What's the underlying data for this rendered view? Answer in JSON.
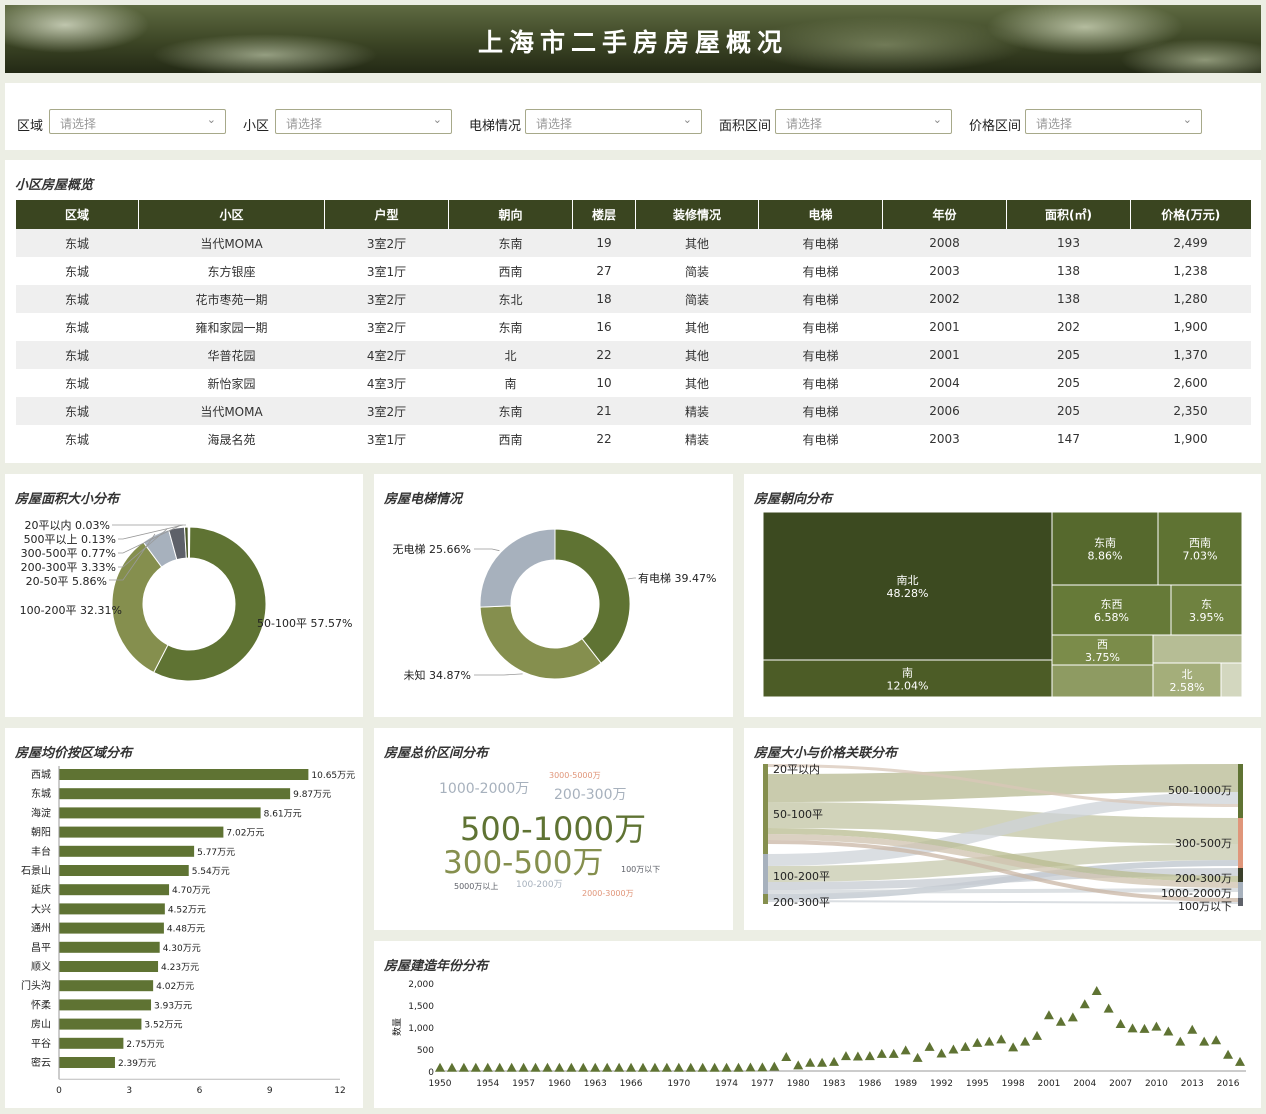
{
  "title": "上海市二手房房屋概况",
  "filters": [
    {
      "label": "区域",
      "placeholder": "请选择"
    },
    {
      "label": "小区",
      "placeholder": "请选择"
    },
    {
      "label": "电梯情况",
      "placeholder": "请选择"
    },
    {
      "label": "面积区间",
      "placeholder": "请选择"
    },
    {
      "label": "价格区间",
      "placeholder": "请选择"
    }
  ],
  "table": {
    "title": "小区房屋概览",
    "headers": [
      "区域",
      "小区",
      "户型",
      "朝向",
      "楼层",
      "装修情况",
      "电梯",
      "年份",
      "面积(㎡)",
      "价格(万元)"
    ],
    "rows": [
      [
        "东城",
        "当代MOMA",
        "3室2厅",
        "东南",
        "19",
        "其他",
        "有电梯",
        "2008",
        "193",
        "2,499"
      ],
      [
        "东城",
        "东方银座",
        "3室1厅",
        "西南",
        "27",
        "简装",
        "有电梯",
        "2003",
        "138",
        "1,238"
      ],
      [
        "东城",
        "花市枣苑一期",
        "3室2厅",
        "东北",
        "18",
        "简装",
        "有电梯",
        "2002",
        "138",
        "1,280"
      ],
      [
        "东城",
        "雍和家园一期",
        "3室2厅",
        "东南",
        "16",
        "其他",
        "有电梯",
        "2001",
        "202",
        "1,900"
      ],
      [
        "东城",
        "华普花园",
        "4室2厅",
        "北",
        "22",
        "其他",
        "有电梯",
        "2001",
        "205",
        "1,370"
      ],
      [
        "东城",
        "新怡家园",
        "4室3厅",
        "南",
        "10",
        "其他",
        "有电梯",
        "2004",
        "205",
        "2,600"
      ],
      [
        "东城",
        "当代MOMA",
        "3室2厅",
        "东南",
        "21",
        "精装",
        "有电梯",
        "2006",
        "205",
        "2,350"
      ],
      [
        "东城",
        "海晟名苑",
        "3室1厅",
        "西南",
        "22",
        "精装",
        "有电梯",
        "2003",
        "147",
        "1,900"
      ]
    ]
  },
  "panels": {
    "area": "房屋面积大小分布",
    "elevator": "房屋电梯情况",
    "orientation": "房屋朝向分布",
    "district_price": "房屋均价按区域分布",
    "price_range": "房屋总价区间分布",
    "size_price": "房屋大小与价格关联分布",
    "year": "房屋建造年份分布"
  },
  "colors": {
    "dark": "#3a4520",
    "olive": "#5f7333",
    "olive_light": "#858f4e",
    "gray_blue": "#a7b1bd",
    "salmon": "#e0967a"
  },
  "chart_data": [
    {
      "type": "pie",
      "name": "area",
      "slices": [
        {
          "label": "50-100平",
          "value": 57.57,
          "text": "50-100平 57.57%"
        },
        {
          "label": "100-200平",
          "value": 32.31,
          "text": "100-200平 32.31%"
        },
        {
          "label": "20-50平",
          "value": 5.86,
          "text": "20-50平 5.86%"
        },
        {
          "label": "200-300平",
          "value": 3.33,
          "text": "200-300平 3.33%"
        },
        {
          "label": "300-500平",
          "value": 0.77,
          "text": "300-500平 0.77%"
        },
        {
          "label": "500平以上",
          "value": 0.13,
          "text": "500平以上 0.13%"
        },
        {
          "label": "20平以内",
          "value": 0.03,
          "text": "20平以内 0.03%"
        }
      ]
    },
    {
      "type": "pie",
      "name": "elevator",
      "slices": [
        {
          "label": "有电梯",
          "value": 39.47,
          "text": "有电梯 39.47%"
        },
        {
          "label": "未知",
          "value": 34.87,
          "text": "未知 34.87%"
        },
        {
          "label": "无电梯",
          "value": 25.66,
          "text": "无电梯 25.66%"
        }
      ]
    },
    {
      "type": "treemap",
      "name": "orientation",
      "items": [
        {
          "label": "南北",
          "value": "48.28%"
        },
        {
          "label": "南",
          "value": "12.04%"
        },
        {
          "label": "东南",
          "value": "8.86%"
        },
        {
          "label": "西南",
          "value": "7.03%"
        },
        {
          "label": "东西",
          "value": "6.58%"
        },
        {
          "label": "东",
          "value": "3.95%"
        },
        {
          "label": "西",
          "value": "3.75%"
        },
        {
          "label": "北",
          "value": "2.58%"
        }
      ]
    },
    {
      "type": "bar",
      "name": "district_price",
      "orientation": "horizontal",
      "categories": [
        "西城",
        "东城",
        "海淀",
        "朝阳",
        "丰台",
        "石景山",
        "延庆",
        "大兴",
        "通州",
        "昌平",
        "顺义",
        "门头沟",
        "怀柔",
        "房山",
        "平谷",
        "密云"
      ],
      "values": [
        10.65,
        9.87,
        8.61,
        7.02,
        5.77,
        5.54,
        4.7,
        4.52,
        4.48,
        4.3,
        4.23,
        4.02,
        3.93,
        3.52,
        2.75,
        2.39
      ],
      "labels": [
        "10.65万元",
        "9.87万元",
        "8.61万元",
        "7.02万元",
        "5.77万元",
        "5.54万元",
        "4.70万元",
        "4.52万元",
        "4.48万元",
        "4.30万元",
        "4.23万元",
        "4.02万元",
        "3.93万元",
        "3.52万元",
        "2.75万元",
        "2.39万元"
      ],
      "xlim": [
        0,
        12
      ],
      "xticks": [
        "0",
        "3",
        "6",
        "9",
        "12"
      ]
    },
    {
      "type": "wordcloud",
      "name": "price_range",
      "words": [
        "500-1000万",
        "300-500万",
        "1000-2000万",
        "200-300万",
        "3000-5000万",
        "100万以下",
        "5000万以上",
        "100-200万",
        "2000-3000万"
      ]
    },
    {
      "type": "sankey",
      "name": "size_price",
      "left_nodes": [
        "20平以内",
        "50-100平",
        "100-200平",
        "200-300平"
      ],
      "right_nodes": [
        "500-1000万",
        "300-500万",
        "200-300万",
        "1000-2000万",
        "100万以下"
      ]
    },
    {
      "type": "scatter",
      "name": "year",
      "ylabel": "数量",
      "ylim": [
        0,
        2000
      ],
      "yticks": [
        "0",
        "500",
        "1,000",
        "1,500",
        "2,000"
      ],
      "xticks": [
        "1950",
        "1954",
        "1957",
        "1960",
        "1963",
        "1966",
        "1970",
        "1974",
        "1977",
        "1980",
        "1983",
        "1986",
        "1989",
        "1992",
        "1995",
        "1998",
        "2001",
        "2004",
        "2007",
        "2010",
        "2013",
        "2016"
      ],
      "points": [
        [
          1950,
          5
        ],
        [
          1951,
          5
        ],
        [
          1952,
          5
        ],
        [
          1953,
          5
        ],
        [
          1954,
          5
        ],
        [
          1955,
          5
        ],
        [
          1956,
          5
        ],
        [
          1957,
          5
        ],
        [
          1958,
          5
        ],
        [
          1959,
          5
        ],
        [
          1960,
          5
        ],
        [
          1961,
          5
        ],
        [
          1962,
          5
        ],
        [
          1963,
          5
        ],
        [
          1964,
          5
        ],
        [
          1965,
          5
        ],
        [
          1966,
          5
        ],
        [
          1967,
          5
        ],
        [
          1968,
          5
        ],
        [
          1969,
          5
        ],
        [
          1970,
          5
        ],
        [
          1971,
          5
        ],
        [
          1972,
          5
        ],
        [
          1973,
          5
        ],
        [
          1974,
          5
        ],
        [
          1975,
          5
        ],
        [
          1976,
          10
        ],
        [
          1977,
          15
        ],
        [
          1978,
          30
        ],
        [
          1979,
          250
        ],
        [
          1980,
          60
        ],
        [
          1981,
          120
        ],
        [
          1982,
          120
        ],
        [
          1983,
          140
        ],
        [
          1984,
          270
        ],
        [
          1985,
          260
        ],
        [
          1986,
          270
        ],
        [
          1987,
          320
        ],
        [
          1988,
          320
        ],
        [
          1989,
          400
        ],
        [
          1990,
          230
        ],
        [
          1991,
          480
        ],
        [
          1992,
          330
        ],
        [
          1993,
          420
        ],
        [
          1994,
          480
        ],
        [
          1995,
          570
        ],
        [
          1996,
          600
        ],
        [
          1997,
          650
        ],
        [
          1998,
          470
        ],
        [
          1999,
          600
        ],
        [
          2000,
          730
        ],
        [
          2001,
          1200
        ],
        [
          2002,
          1050
        ],
        [
          2003,
          1150
        ],
        [
          2004,
          1450
        ],
        [
          2005,
          1750
        ],
        [
          2006,
          1350
        ],
        [
          2007,
          1000
        ],
        [
          2008,
          900
        ],
        [
          2009,
          890
        ],
        [
          2010,
          940
        ],
        [
          2011,
          830
        ],
        [
          2012,
          600
        ],
        [
          2013,
          870
        ],
        [
          2014,
          600
        ],
        [
          2015,
          630
        ],
        [
          2016,
          300
        ],
        [
          2017,
          140
        ]
      ]
    }
  ]
}
